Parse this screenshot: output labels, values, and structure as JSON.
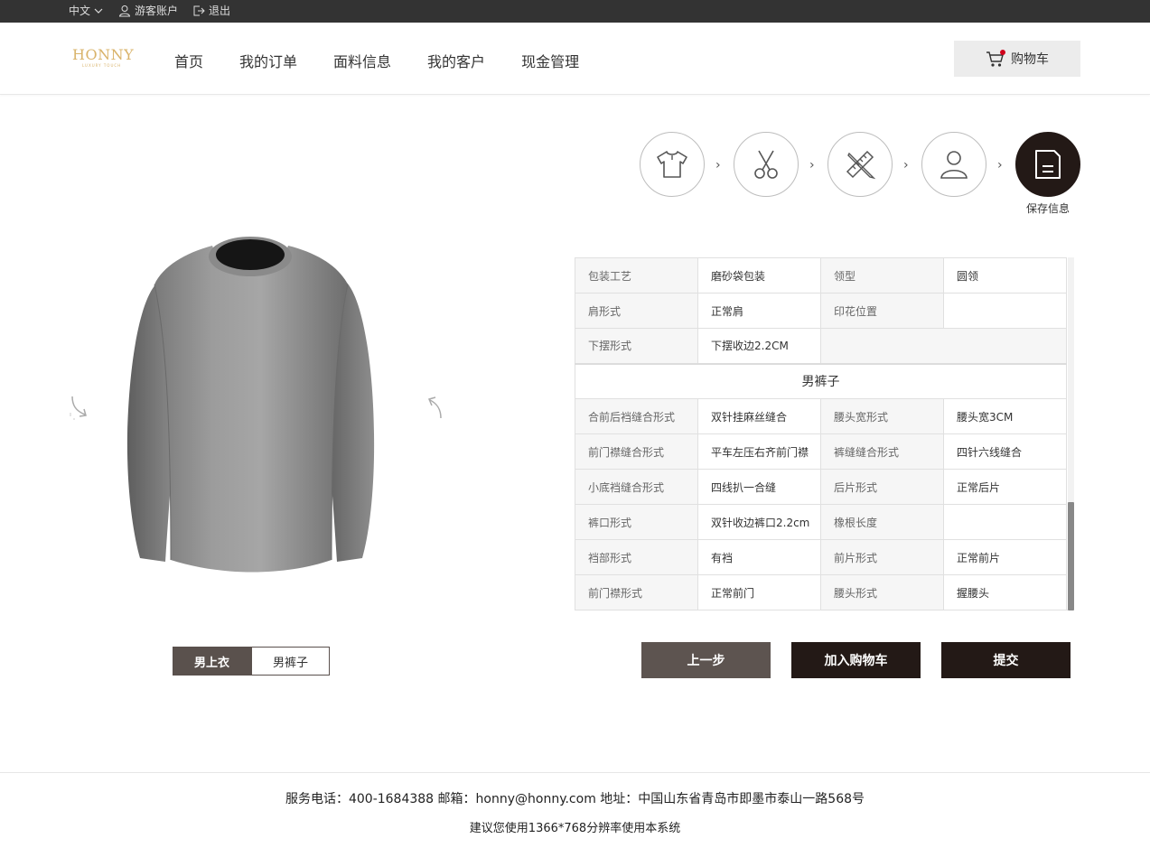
{
  "topbar": {
    "language": "中文",
    "guest_account": "游客账户",
    "logout": "退出"
  },
  "header": {
    "logo": {
      "brand": "HONNY",
      "tagline": "LUXURY TOUCH"
    },
    "nav": [
      "首页",
      "我的订单",
      "面料信息",
      "我的客户",
      "现金管理"
    ],
    "cart_label": "购物车"
  },
  "steps": {
    "items": [
      {
        "icon": "shirt-icon"
      },
      {
        "icon": "scissors-icon"
      },
      {
        "icon": "ruler-pencil-icon"
      },
      {
        "icon": "user-icon"
      },
      {
        "icon": "save-icon",
        "label": "保存信息",
        "active": true
      }
    ]
  },
  "spec_table": {
    "top_rows": [
      [
        "包装工艺",
        "磨砂袋包装",
        "领型",
        "圆领"
      ],
      [
        "肩形式",
        "正常肩",
        "印花位置",
        ""
      ],
      [
        "下摆形式",
        "下摆收边2.2CM"
      ]
    ],
    "section_title": "男裤子",
    "section_rows": [
      [
        "合前后裆缝合形式",
        "双针挂麻丝缝合",
        "腰头宽形式",
        "腰头宽3CM"
      ],
      [
        "前门襟缝合形式",
        "平车左压右齐前门襟",
        "裤缝缝合形式",
        "四针六线缝合"
      ],
      [
        "小底裆缝合形式",
        "四线扒一合缝",
        "后片形式",
        "正常后片"
      ],
      [
        "裤口形式",
        "双针收边裤口2.2cm",
        "橡根长度",
        ""
      ],
      [
        "裆部形式",
        "有裆",
        "前片形式",
        "正常前片"
      ],
      [
        "前门襟形式",
        "正常前门",
        "腰头形式",
        "握腰头"
      ]
    ]
  },
  "garment_tabs": {
    "shirt": "男上衣",
    "pants": "男裤子",
    "selected": "男上衣"
  },
  "actions": {
    "prev": "上一步",
    "add_to_cart": "加入购物车",
    "submit": "提交"
  },
  "footer": {
    "contact": "服务电话：400-1684388 邮箱：honny@honny.com 地址：中国山东省青岛市即墨市泰山一路568号",
    "resolution_hint": "建议您使用1366*768分辨率使用本系统"
  },
  "colors": {
    "dark": "#231916",
    "muted": "#5d5450",
    "accent": "#d9b36a",
    "topbar": "#333333"
  }
}
